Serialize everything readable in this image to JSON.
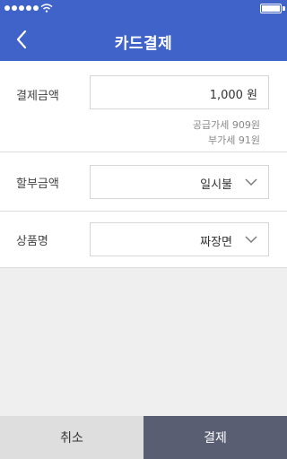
{
  "header": {
    "title": "카드결제",
    "color": "#3f63c9"
  },
  "form": {
    "amount": {
      "label": "결제금액",
      "value": "1,000 원",
      "supply_value": "공급가세 909원",
      "vat": "부가세 91원"
    },
    "installment": {
      "label": "할부금액",
      "selected": "일시불"
    },
    "product": {
      "label": "상품명",
      "selected": "짜장면"
    }
  },
  "footer": {
    "cancel_label": "취소",
    "pay_label": "결제"
  },
  "icons": [
    "back-arrow-icon",
    "wifi-icon",
    "battery-icon",
    "chevron-down-icon"
  ]
}
